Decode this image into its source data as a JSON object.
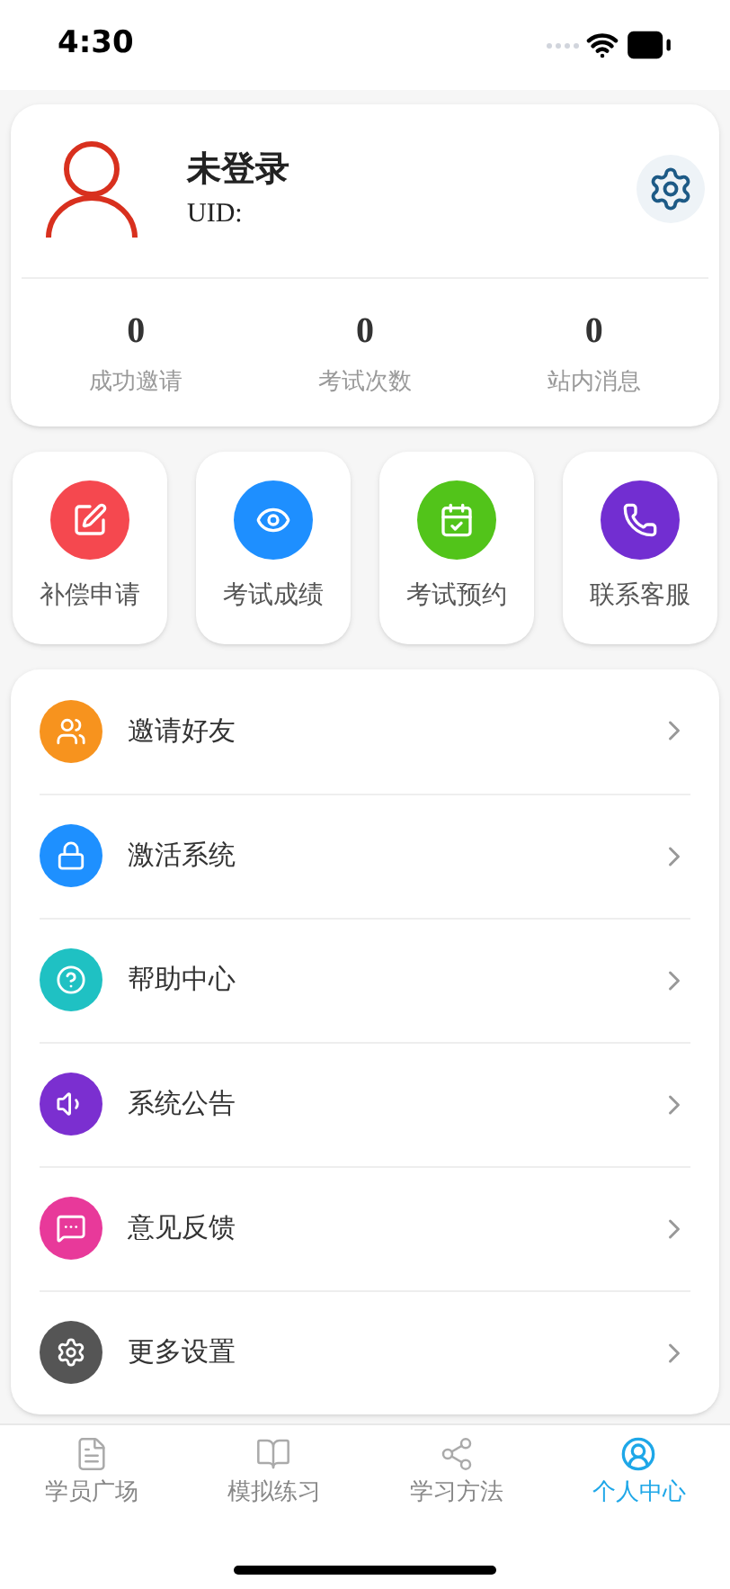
{
  "status_bar": {
    "time": "4:30"
  },
  "profile": {
    "name": "未登录",
    "uid": "UID:",
    "stats": [
      {
        "value": "0",
        "label": "成功邀请"
      },
      {
        "value": "0",
        "label": "考试次数"
      },
      {
        "value": "0",
        "label": "站内消息"
      }
    ]
  },
  "shortcuts": [
    {
      "label": "补偿申请",
      "color": "#f5484f"
    },
    {
      "label": "考试成绩",
      "color": "#1e8fff"
    },
    {
      "label": "考试预约",
      "color": "#52c41a"
    },
    {
      "label": "联系客服",
      "color": "#722ed1"
    }
  ],
  "menu": [
    {
      "label": "邀请好友",
      "color": "#f7931e"
    },
    {
      "label": "激活系统",
      "color": "#1e90ff"
    },
    {
      "label": "帮助中心",
      "color": "#1fc1c3"
    },
    {
      "label": "系统公告",
      "color": "#7b2fd0"
    },
    {
      "label": "意见反馈",
      "color": "#e8399a"
    },
    {
      "label": "更多设置",
      "color": "#555555"
    }
  ],
  "tab_bar": [
    {
      "label": "学员广场",
      "selected": false
    },
    {
      "label": "模拟练习",
      "selected": false
    },
    {
      "label": "学习方法",
      "selected": false
    },
    {
      "label": "个人中心",
      "selected": true
    }
  ]
}
